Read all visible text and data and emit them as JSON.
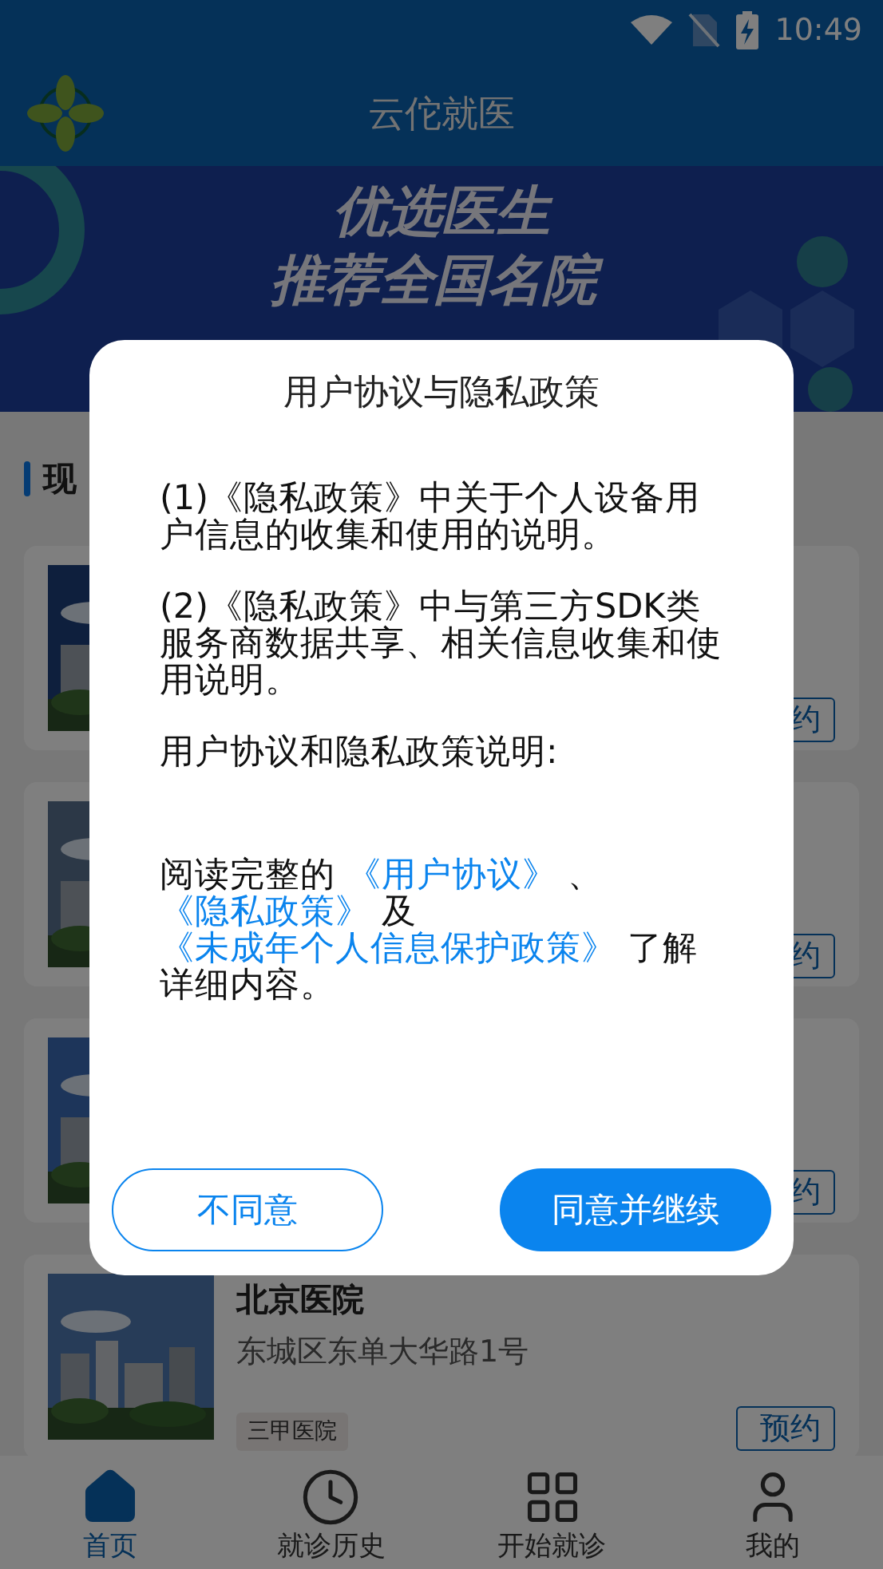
{
  "status_bar": {
    "time": "10:49"
  },
  "app_bar": {
    "title": "云佗就医"
  },
  "banner": {
    "headline": "优选医生",
    "subheadline": "推荐全国名院"
  },
  "section": {
    "title": "现"
  },
  "hospitals": [
    {
      "button": "约"
    },
    {
      "button": "约"
    },
    {
      "button": "约"
    },
    {
      "name": "北京医院",
      "address": "东城区东单大华路1号",
      "tag": "三甲医院",
      "button": "预约"
    }
  ],
  "tab_bar": {
    "items": [
      {
        "label": "首页",
        "selected": true
      },
      {
        "label": "就诊历史",
        "selected": false
      },
      {
        "label": "开始就诊",
        "selected": false
      },
      {
        "label": "我的",
        "selected": false
      }
    ]
  },
  "dialog": {
    "title": "用户协议与隐私政策",
    "paragraphs": [
      "(1)《隐私政策》中关于个人设备用户信息的收集和使用的说明。",
      "(2)《隐私政策》中与第三方SDK类服务商数据共享、相关信息收集和使用说明。",
      "用户协议和隐私政策说明:"
    ],
    "notice": [
      {
        "kind": "text",
        "text": "阅读完整的 "
      },
      {
        "kind": "link",
        "text": "《用户协议》"
      },
      {
        "kind": "text",
        "text": " 、 "
      },
      {
        "kind": "link",
        "text": "《隐私政策》"
      },
      {
        "kind": "text",
        "text": " 及 "
      },
      {
        "kind": "link",
        "text": "《未成年个人信息保护政策》"
      },
      {
        "kind": "text",
        "text": " 了解详细内容。"
      }
    ],
    "buttons": [
      {
        "label": "不同意",
        "kind": "outline"
      },
      {
        "label": "同意并继续",
        "kind": "primary"
      }
    ]
  }
}
